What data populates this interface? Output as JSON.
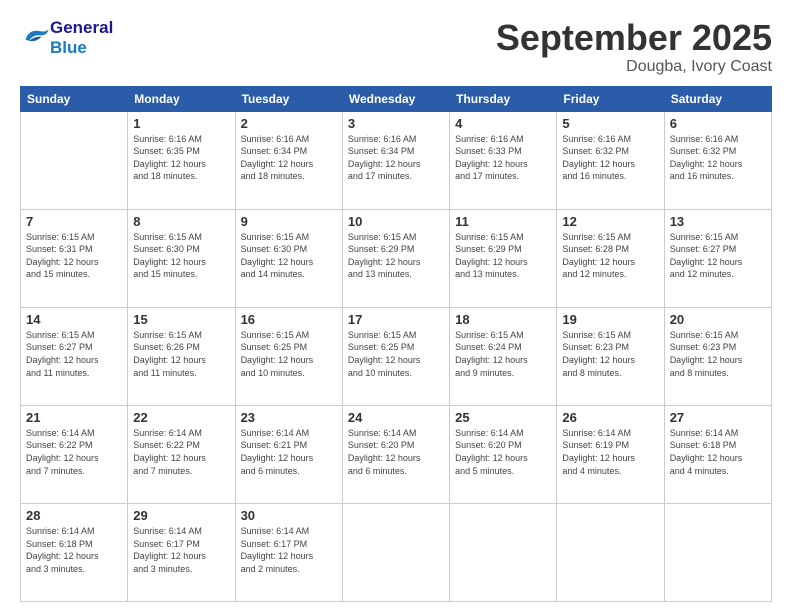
{
  "logo": {
    "line1": "General",
    "line2": "Blue"
  },
  "header": {
    "month": "September 2025",
    "location": "Dougba, Ivory Coast"
  },
  "weekdays": [
    "Sunday",
    "Monday",
    "Tuesday",
    "Wednesday",
    "Thursday",
    "Friday",
    "Saturday"
  ],
  "weeks": [
    [
      {
        "day": "",
        "info": ""
      },
      {
        "day": "1",
        "info": "Sunrise: 6:16 AM\nSunset: 6:35 PM\nDaylight: 12 hours\nand 18 minutes."
      },
      {
        "day": "2",
        "info": "Sunrise: 6:16 AM\nSunset: 6:34 PM\nDaylight: 12 hours\nand 18 minutes."
      },
      {
        "day": "3",
        "info": "Sunrise: 6:16 AM\nSunset: 6:34 PM\nDaylight: 12 hours\nand 17 minutes."
      },
      {
        "day": "4",
        "info": "Sunrise: 6:16 AM\nSunset: 6:33 PM\nDaylight: 12 hours\nand 17 minutes."
      },
      {
        "day": "5",
        "info": "Sunrise: 6:16 AM\nSunset: 6:32 PM\nDaylight: 12 hours\nand 16 minutes."
      },
      {
        "day": "6",
        "info": "Sunrise: 6:16 AM\nSunset: 6:32 PM\nDaylight: 12 hours\nand 16 minutes."
      }
    ],
    [
      {
        "day": "7",
        "info": "Sunrise: 6:15 AM\nSunset: 6:31 PM\nDaylight: 12 hours\nand 15 minutes."
      },
      {
        "day": "8",
        "info": "Sunrise: 6:15 AM\nSunset: 6:30 PM\nDaylight: 12 hours\nand 15 minutes."
      },
      {
        "day": "9",
        "info": "Sunrise: 6:15 AM\nSunset: 6:30 PM\nDaylight: 12 hours\nand 14 minutes."
      },
      {
        "day": "10",
        "info": "Sunrise: 6:15 AM\nSunset: 6:29 PM\nDaylight: 12 hours\nand 13 minutes."
      },
      {
        "day": "11",
        "info": "Sunrise: 6:15 AM\nSunset: 6:29 PM\nDaylight: 12 hours\nand 13 minutes."
      },
      {
        "day": "12",
        "info": "Sunrise: 6:15 AM\nSunset: 6:28 PM\nDaylight: 12 hours\nand 12 minutes."
      },
      {
        "day": "13",
        "info": "Sunrise: 6:15 AM\nSunset: 6:27 PM\nDaylight: 12 hours\nand 12 minutes."
      }
    ],
    [
      {
        "day": "14",
        "info": "Sunrise: 6:15 AM\nSunset: 6:27 PM\nDaylight: 12 hours\nand 11 minutes."
      },
      {
        "day": "15",
        "info": "Sunrise: 6:15 AM\nSunset: 6:26 PM\nDaylight: 12 hours\nand 11 minutes."
      },
      {
        "day": "16",
        "info": "Sunrise: 6:15 AM\nSunset: 6:25 PM\nDaylight: 12 hours\nand 10 minutes."
      },
      {
        "day": "17",
        "info": "Sunrise: 6:15 AM\nSunset: 6:25 PM\nDaylight: 12 hours\nand 10 minutes."
      },
      {
        "day": "18",
        "info": "Sunrise: 6:15 AM\nSunset: 6:24 PM\nDaylight: 12 hours\nand 9 minutes."
      },
      {
        "day": "19",
        "info": "Sunrise: 6:15 AM\nSunset: 6:23 PM\nDaylight: 12 hours\nand 8 minutes."
      },
      {
        "day": "20",
        "info": "Sunrise: 6:15 AM\nSunset: 6:23 PM\nDaylight: 12 hours\nand 8 minutes."
      }
    ],
    [
      {
        "day": "21",
        "info": "Sunrise: 6:14 AM\nSunset: 6:22 PM\nDaylight: 12 hours\nand 7 minutes."
      },
      {
        "day": "22",
        "info": "Sunrise: 6:14 AM\nSunset: 6:22 PM\nDaylight: 12 hours\nand 7 minutes."
      },
      {
        "day": "23",
        "info": "Sunrise: 6:14 AM\nSunset: 6:21 PM\nDaylight: 12 hours\nand 6 minutes."
      },
      {
        "day": "24",
        "info": "Sunrise: 6:14 AM\nSunset: 6:20 PM\nDaylight: 12 hours\nand 6 minutes."
      },
      {
        "day": "25",
        "info": "Sunrise: 6:14 AM\nSunset: 6:20 PM\nDaylight: 12 hours\nand 5 minutes."
      },
      {
        "day": "26",
        "info": "Sunrise: 6:14 AM\nSunset: 6:19 PM\nDaylight: 12 hours\nand 4 minutes."
      },
      {
        "day": "27",
        "info": "Sunrise: 6:14 AM\nSunset: 6:18 PM\nDaylight: 12 hours\nand 4 minutes."
      }
    ],
    [
      {
        "day": "28",
        "info": "Sunrise: 6:14 AM\nSunset: 6:18 PM\nDaylight: 12 hours\nand 3 minutes."
      },
      {
        "day": "29",
        "info": "Sunrise: 6:14 AM\nSunset: 6:17 PM\nDaylight: 12 hours\nand 3 minutes."
      },
      {
        "day": "30",
        "info": "Sunrise: 6:14 AM\nSunset: 6:17 PM\nDaylight: 12 hours\nand 2 minutes."
      },
      {
        "day": "",
        "info": ""
      },
      {
        "day": "",
        "info": ""
      },
      {
        "day": "",
        "info": ""
      },
      {
        "day": "",
        "info": ""
      }
    ]
  ]
}
